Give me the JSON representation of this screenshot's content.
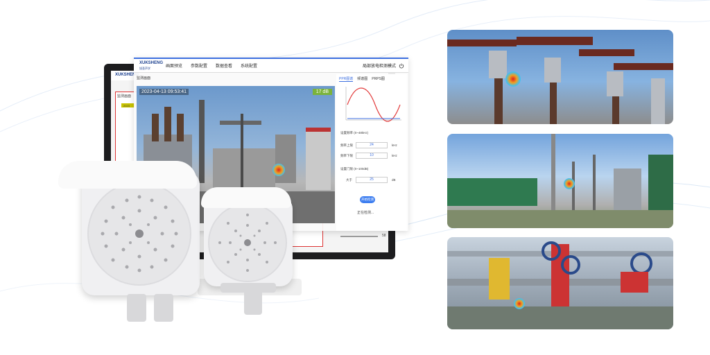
{
  "app": {
    "logo": "XUKSHENG",
    "logo_sub": "旭圣声学",
    "nav": [
      "画面预览",
      "参数配置",
      "数据查看",
      "系统配置"
    ],
    "mode": "局部放电检测模式"
  },
  "monitor": {
    "tab": "监测画面",
    "left_panel_title": "监测画面",
    "left_panel_year": "2023"
  },
  "camera": {
    "timestamp": "2023-04-13 09:53:41",
    "db": "17 dB"
  },
  "panel": {
    "tabs": [
      "PPR图谱",
      "频谱图",
      "PRPS图"
    ],
    "freq_range_label": "设置频率 (0~48kHz)",
    "upper_label": "频率上限",
    "upper_value": "24",
    "upper_unit": "kHz",
    "lower_label": "频率下限",
    "lower_value": "10",
    "lower_unit": "kHz",
    "threshold_label": "设置门限 (0~100dB)",
    "size_label": "大于",
    "size_value": "25",
    "size_unit": "dB",
    "start_button": "开始检测",
    "status": "正在检测...",
    "slider_value": "58"
  },
  "colors": {
    "accent": "#3d6fe0",
    "frame_red": "#dd3333",
    "db_badge": "#7bb33b"
  },
  "icons": {
    "power": "power-icon"
  }
}
